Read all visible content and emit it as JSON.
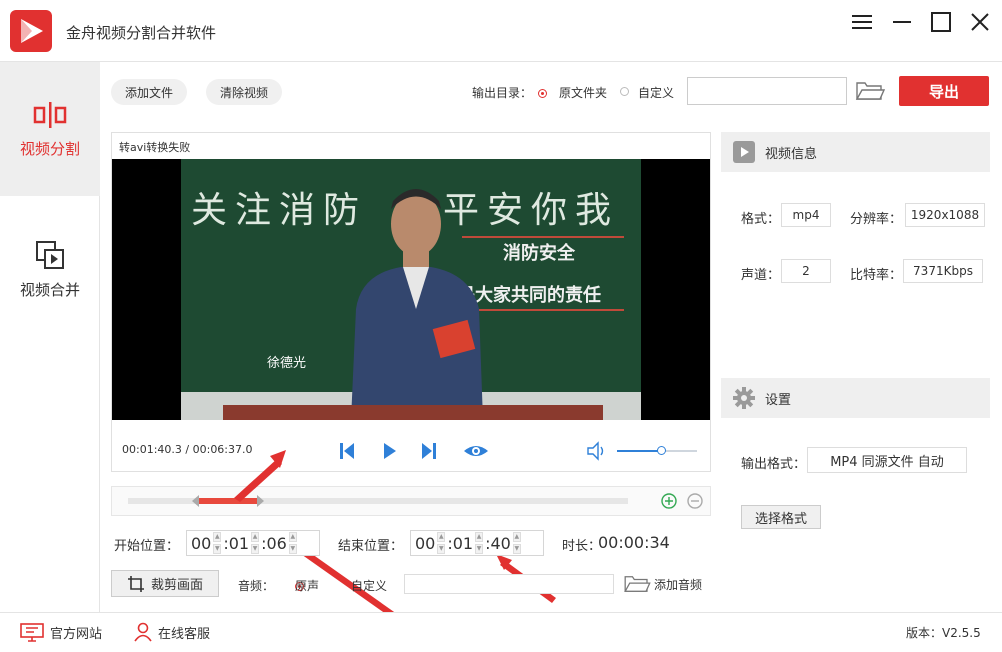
{
  "app": {
    "title": "金舟视频分割合并软件"
  },
  "sidebar": {
    "items": [
      {
        "label": "视频分割",
        "active": true
      },
      {
        "label": "视频合并",
        "active": false
      }
    ]
  },
  "toolbar": {
    "add_file": "添加文件",
    "clear_video": "清除视频",
    "output_dir_label": "输出目录：",
    "opt_source": "原文件夹",
    "opt_custom": "自定义",
    "path_value": "",
    "export": "导出"
  },
  "video": {
    "file_title": "转avi转换失败",
    "overlay": {
      "board_left": "关注消防",
      "board_right": "平安你我",
      "line1": "消防安全",
      "line2": "是大家共同的责任",
      "person_name": "徐德光"
    },
    "time_current": "00:01:40.3",
    "time_total": "00:06:37.0",
    "time_sep": " / ",
    "volume": 0.55
  },
  "trim": {
    "start_label": "开始位置：",
    "start": [
      "00",
      "01",
      "06"
    ],
    "end_label": "结束位置：",
    "end": [
      "00",
      "01",
      "40"
    ],
    "duration_label": "时长：",
    "duration": "00:00:34",
    "range_start": 0.142,
    "range_end": 0.257
  },
  "bottom_controls": {
    "crop": "裁剪画面",
    "audio_label": "音频：",
    "audio_original": "原声",
    "audio_custom": "自定义",
    "audio_path": "",
    "add_audio": "添加音频"
  },
  "info": {
    "header": "视频信息",
    "format_label": "格式：",
    "format": "mp4",
    "resolution_label": "分辨率：",
    "resolution": "1920x1088",
    "channel_label": "声道：",
    "channel": "2",
    "bitrate_label": "比特率：",
    "bitrate": "7371Kbps"
  },
  "settings": {
    "header": "设置",
    "output_format_label": "输出格式：",
    "output_format": "MP4 同源文件 自动",
    "choose_format": "选择格式"
  },
  "footer": {
    "website": "官方网站",
    "support": "在线客服",
    "version": "版本：V2.5.5"
  },
  "colors": {
    "accent": "#e13130",
    "play_blue": "#2f80d8",
    "green": "#33a853"
  }
}
